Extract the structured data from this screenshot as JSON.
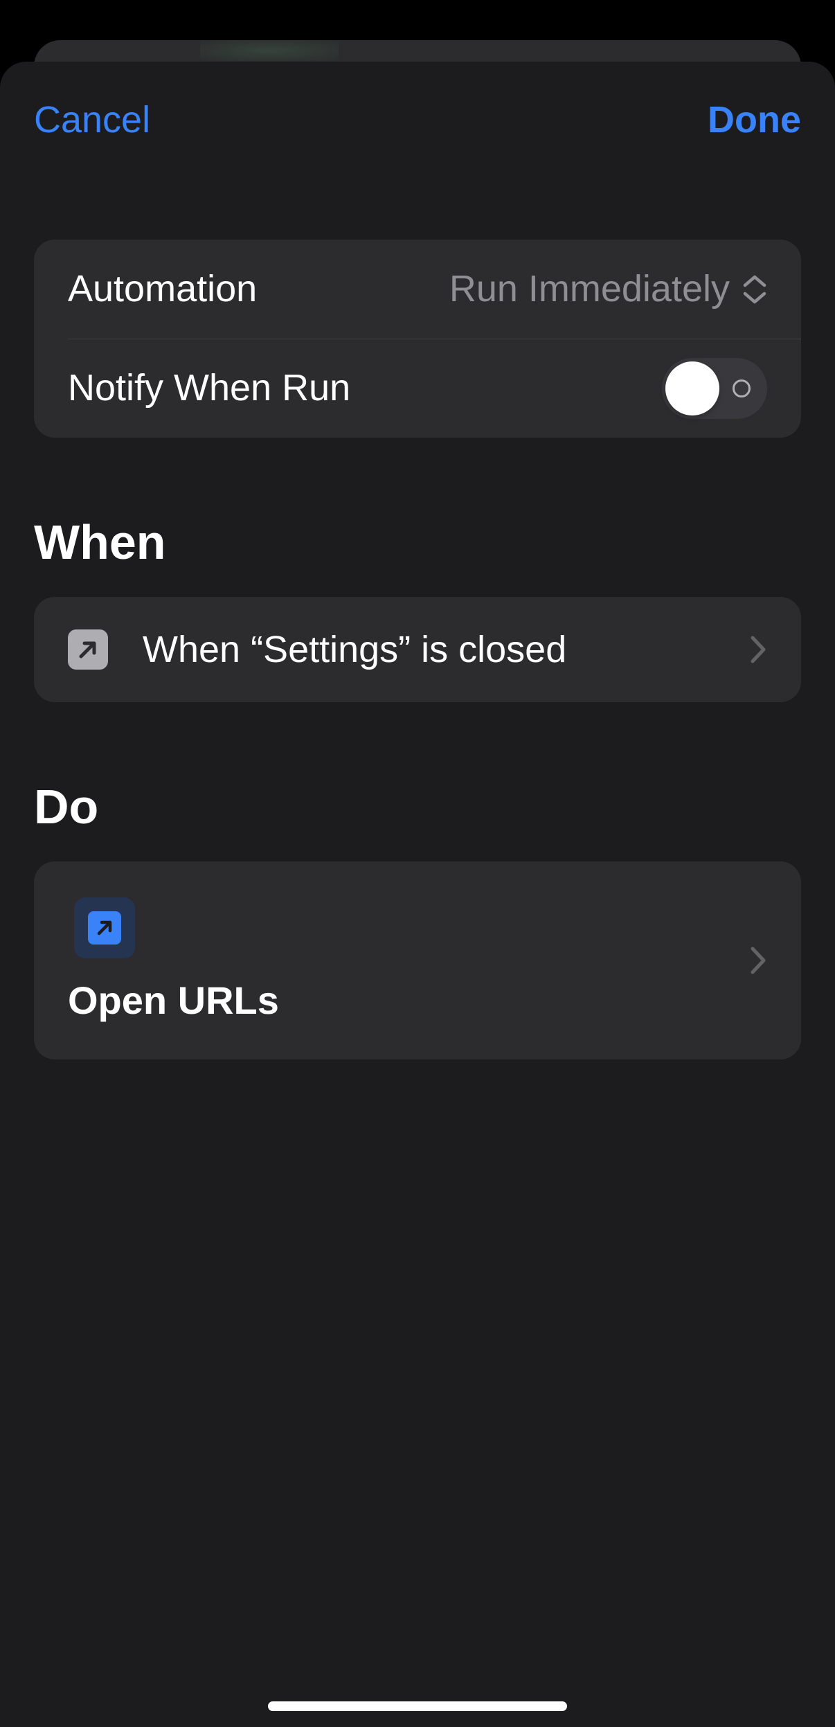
{
  "nav": {
    "cancel_label": "Cancel",
    "done_label": "Done"
  },
  "settings": {
    "automation_label": "Automation",
    "automation_value": "Run Immediately",
    "notify_label": "Notify When Run",
    "notify_enabled": false
  },
  "when": {
    "section_title": "When",
    "trigger_text": "When “Settings” is closed",
    "trigger_icon": "arrow-up-right-square-icon"
  },
  "do": {
    "section_title": "Do",
    "action_title": "Open URLs",
    "action_icon": "open-url-arrow-icon"
  },
  "colors": {
    "accent": "#3a82f7",
    "background": "#1c1c1e",
    "grouped_cell": "#2c2c2e",
    "secondary_text": "#8e8e93"
  }
}
